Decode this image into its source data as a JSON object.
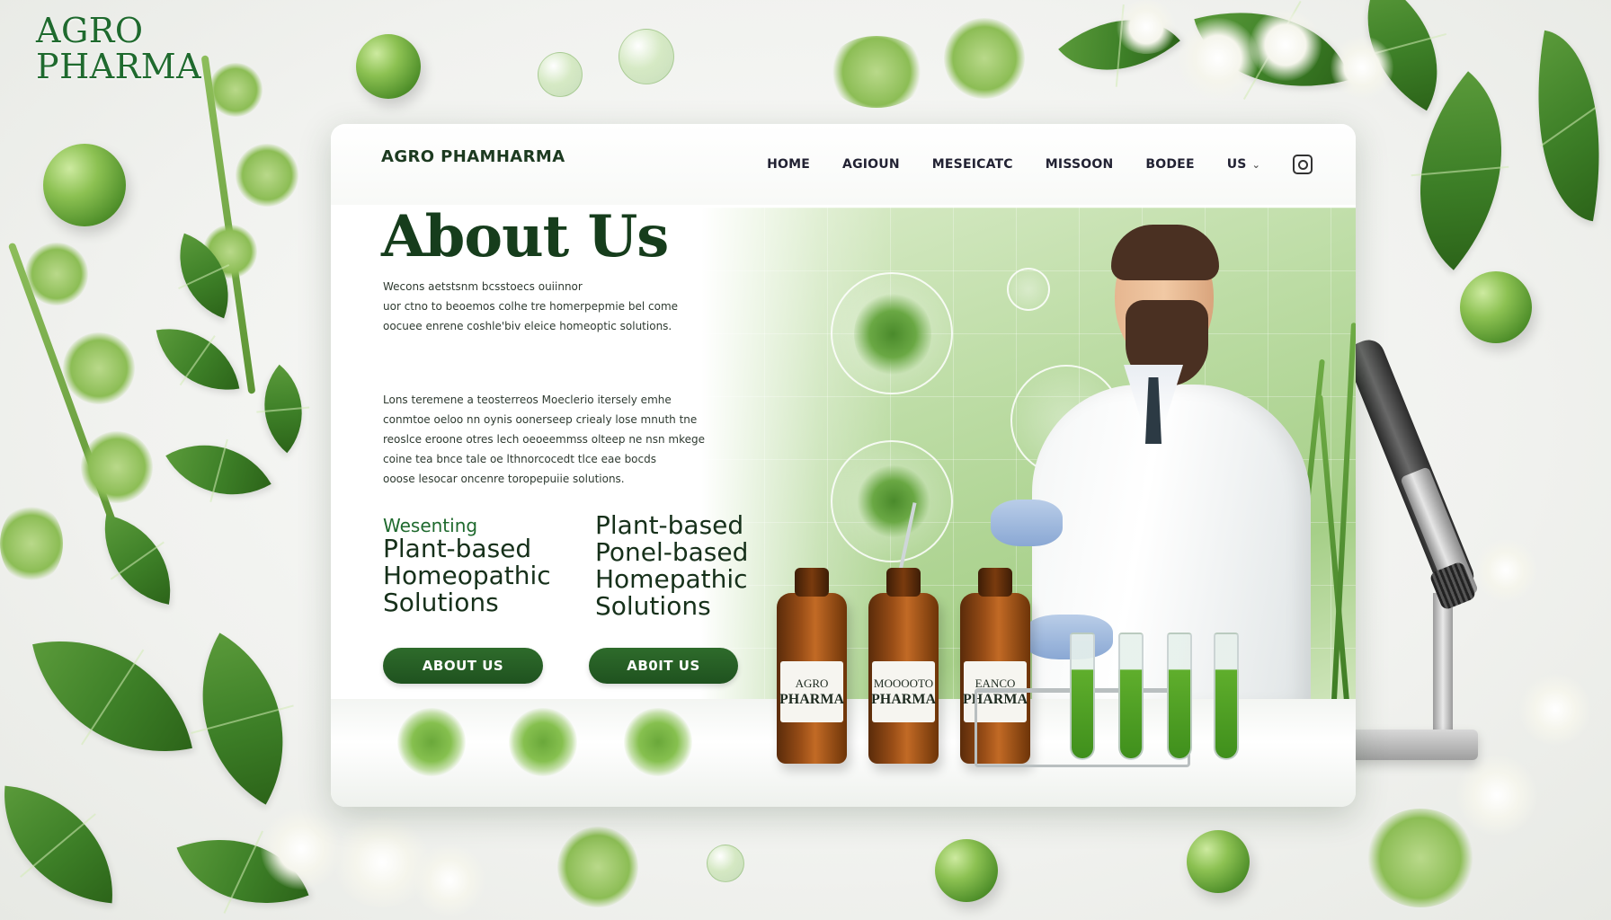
{
  "corner_logo": {
    "line1": "AGRO",
    "line2": "PHARMA"
  },
  "nav": {
    "brand": "AGRO PHAMHARMA",
    "links": [
      "HOME",
      "AGIOUN",
      "MESEICATC",
      "MISSOON",
      "BODEE"
    ],
    "us_label": "US",
    "us_icon": "chevron-down-icon",
    "right_icon": "square-icon"
  },
  "hero": {
    "title": "About Us",
    "paragraph1": [
      "Wecons aetstsnm bcsstoecs ouiinnor",
      "uor ctno to beoemos colhe tre homerpepmie bel come",
      "oocuee enrene coshle'biv eleice homeoptic solutions."
    ],
    "paragraph2": [
      "Lons teremene a teosterreos Moeclerio itersely emhe",
      "conmtoe oeloo nn oynis oonerseep criealy lose mnuth tne",
      "reoslce eroone otres lech oeoeemmss olteep ne nsn mkege",
      "coine tea bnce tale oe lthnorcocedt tlce eae bocds",
      "ooose  lesocar oncenre toropepuiie solutions."
    ]
  },
  "taglines": [
    {
      "lead": "Wesenting",
      "lines": [
        "Plant-based",
        "Homeopathic",
        "Solutions"
      ]
    },
    {
      "lead": "",
      "lines": [
        "Plant-based",
        "Ponel-based",
        "Homepathic",
        "Solutions"
      ]
    }
  ],
  "buttons": {
    "primary": "ABOUT US",
    "secondary": "AB0IT US"
  },
  "bottles": [
    {
      "top": "AGRO",
      "bottom": "PHARMA"
    },
    {
      "top": "MOOOOTO",
      "bottom": "PHARMA"
    },
    {
      "top": "EANCO",
      "bottom": "PHARMA"
    }
  ],
  "colors": {
    "brand_green": "#1f521f",
    "accent_green": "#5fae2c",
    "title": "#163d1c"
  }
}
